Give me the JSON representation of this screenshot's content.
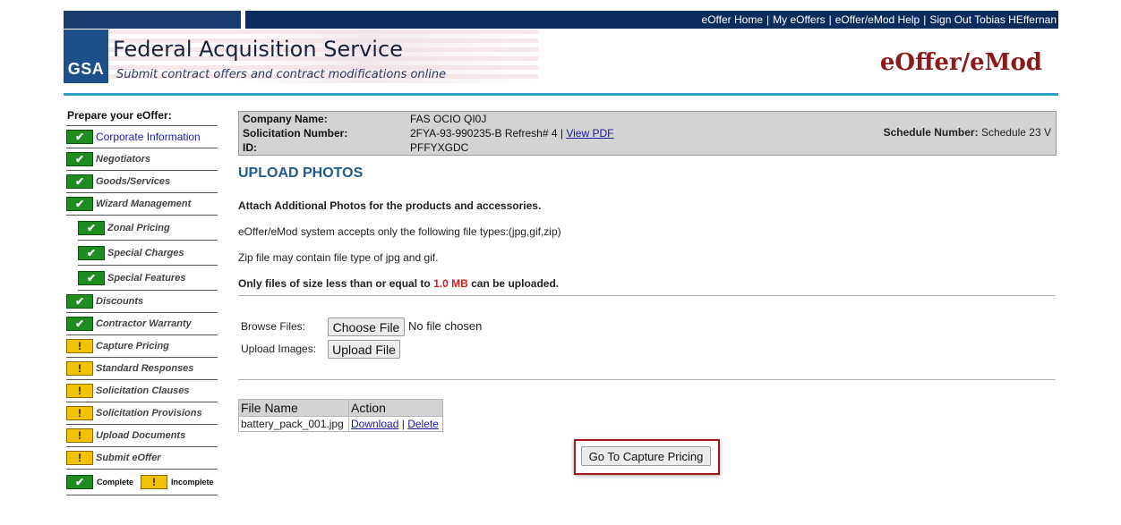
{
  "top_nav": {
    "links": [
      "eOffer Home",
      "My eOffers",
      "eOffer/eMod Help",
      "Sign Out Tobias HEffernan"
    ]
  },
  "header": {
    "logo_text": "GSA",
    "title": "Federal Acquisition Service",
    "subtitle": "Submit contract offers and contract modifications online",
    "app_name": "eOffer/eMod"
  },
  "sidebar": {
    "heading": "Prepare your eOffer:",
    "items": [
      {
        "label": "Corporate Information",
        "status": "complete",
        "sub": false,
        "link": true
      },
      {
        "label": "Negotiators",
        "status": "complete",
        "sub": false
      },
      {
        "label": "Goods/Services",
        "status": "complete",
        "sub": false
      },
      {
        "label": "Wizard Management",
        "status": "complete",
        "sub": false
      },
      {
        "label": "Zonal Pricing",
        "status": "complete",
        "sub": true
      },
      {
        "label": "Special Charges",
        "status": "complete",
        "sub": true
      },
      {
        "label": "Special Features",
        "status": "complete",
        "sub": true
      },
      {
        "label": "Discounts",
        "status": "complete",
        "sub": false
      },
      {
        "label": "Contractor Warranty",
        "status": "complete",
        "sub": false
      },
      {
        "label": "Capture Pricing",
        "status": "incomplete",
        "sub": false
      },
      {
        "label": "Standard Responses",
        "status": "incomplete",
        "sub": false
      },
      {
        "label": "Solicitation Clauses",
        "status": "incomplete",
        "sub": false
      },
      {
        "label": "Solicitation Provisions",
        "status": "incomplete",
        "sub": false
      },
      {
        "label": "Upload Documents",
        "status": "incomplete",
        "sub": false
      },
      {
        "label": "Submit eOffer",
        "status": "incomplete",
        "sub": false
      }
    ],
    "legend": {
      "complete": "Complete",
      "incomplete": "Incomplete"
    }
  },
  "info": {
    "company_label": "Company Name:",
    "company_value": "FAS OCIO QI0J",
    "solicitation_label": "Solicitation Number:",
    "solicitation_value": "2FYA-93-990235-B Refresh# 4 |",
    "view_pdf": "View PDF",
    "id_label": "ID:",
    "id_value": "PFFYXGDC",
    "schedule_label": "Schedule Number:",
    "schedule_value": "Schedule 23 V"
  },
  "main": {
    "title": "UPLOAD PHOTOS",
    "line1": "Attach Additional Photos for the products and accessories.",
    "line2": "eOffer/eMod system accepts only the following file types:(jpg,gif,zip)",
    "line3": "Zip file may contain file type of jpg and gif.",
    "line4_pre": "Only files of size less than or equal to",
    "line4_size": "1.0 MB",
    "line4_post": "can be uploaded.",
    "browse_label": "Browse Files:",
    "choose_file": "Choose File",
    "no_file": "No file chosen",
    "upload_label": "Upload Images:",
    "upload_button": "Upload File",
    "table_headers": [
      "File Name",
      "Action"
    ],
    "rows": [
      {
        "file_name": "battery_pack_001.jpg",
        "download": "Download",
        "sep": "|",
        "delete": "Delete"
      }
    ],
    "go_button": "Go To Capture Pricing"
  }
}
